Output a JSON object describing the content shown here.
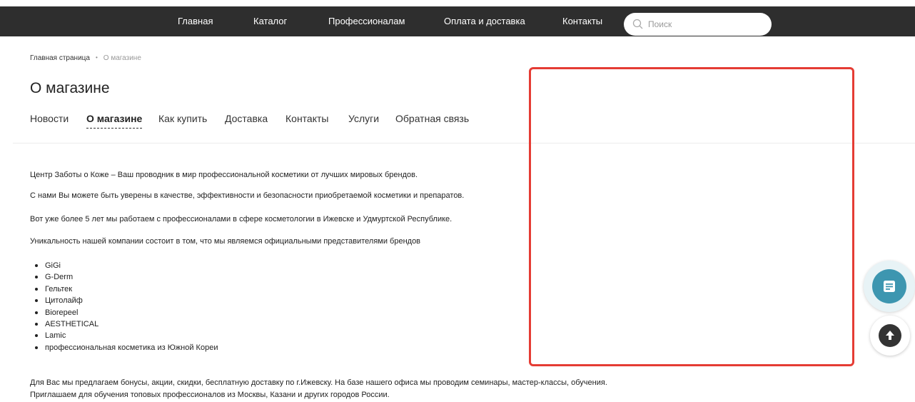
{
  "nav": {
    "items": [
      "Главная",
      "Каталог",
      "Профессионалам",
      "Оплата и доставка",
      "Контакты"
    ],
    "search_placeholder": "Поиск"
  },
  "breadcrumb": {
    "home": "Главная страница",
    "separator": "•",
    "current": "О магазине"
  },
  "page_title": "О магазине",
  "tabs": {
    "items": [
      "Новости",
      "О магазине",
      "Как купить",
      "Доставка",
      "Контакты",
      "Услуги",
      "Обратная связь"
    ],
    "active": "О магазине"
  },
  "content": {
    "paragraphs": [
      "Центр Заботы о Коже – Ваш проводник в мир профессиональной косметики от лучших мировых брендов.",
      "С нами Вы можете быть уверены в качестве, эффективности и безопасности приобретаемой косметики и препаратов.",
      "Вот уже более 5 лет мы работаем с профессионалами в сфере косметологии в Ижевске и Удмуртской Республике.",
      "Уникальность нашей компании состоит в том, что мы являемся официальными представителями брендов"
    ],
    "brands": [
      "GiGi",
      "G-Derm",
      "Гельтек",
      "Цитолайф",
      "Biorepeel",
      "AESTHETICAL",
      "Lamic",
      "профессиональная косметика из Южной Кореи"
    ],
    "footer_lines": [
      "Для Вас мы предлагаем бонусы, акции, скидки, бесплатную доставку по г.Ижевску. На базе нашего офиса мы проводим семинары, мастер-классы, обучения.",
      "Приглашаем для обучения топовых профессионалов из Москвы, Казани и других городов России."
    ]
  },
  "icons": {
    "search": "search-icon",
    "chat": "chat-icon",
    "scroll_up": "arrow-up-icon"
  },
  "colors": {
    "nav_bg": "#2e2e2e",
    "chat_button": "#3d96b0",
    "annotation_box": "#e53c34"
  }
}
